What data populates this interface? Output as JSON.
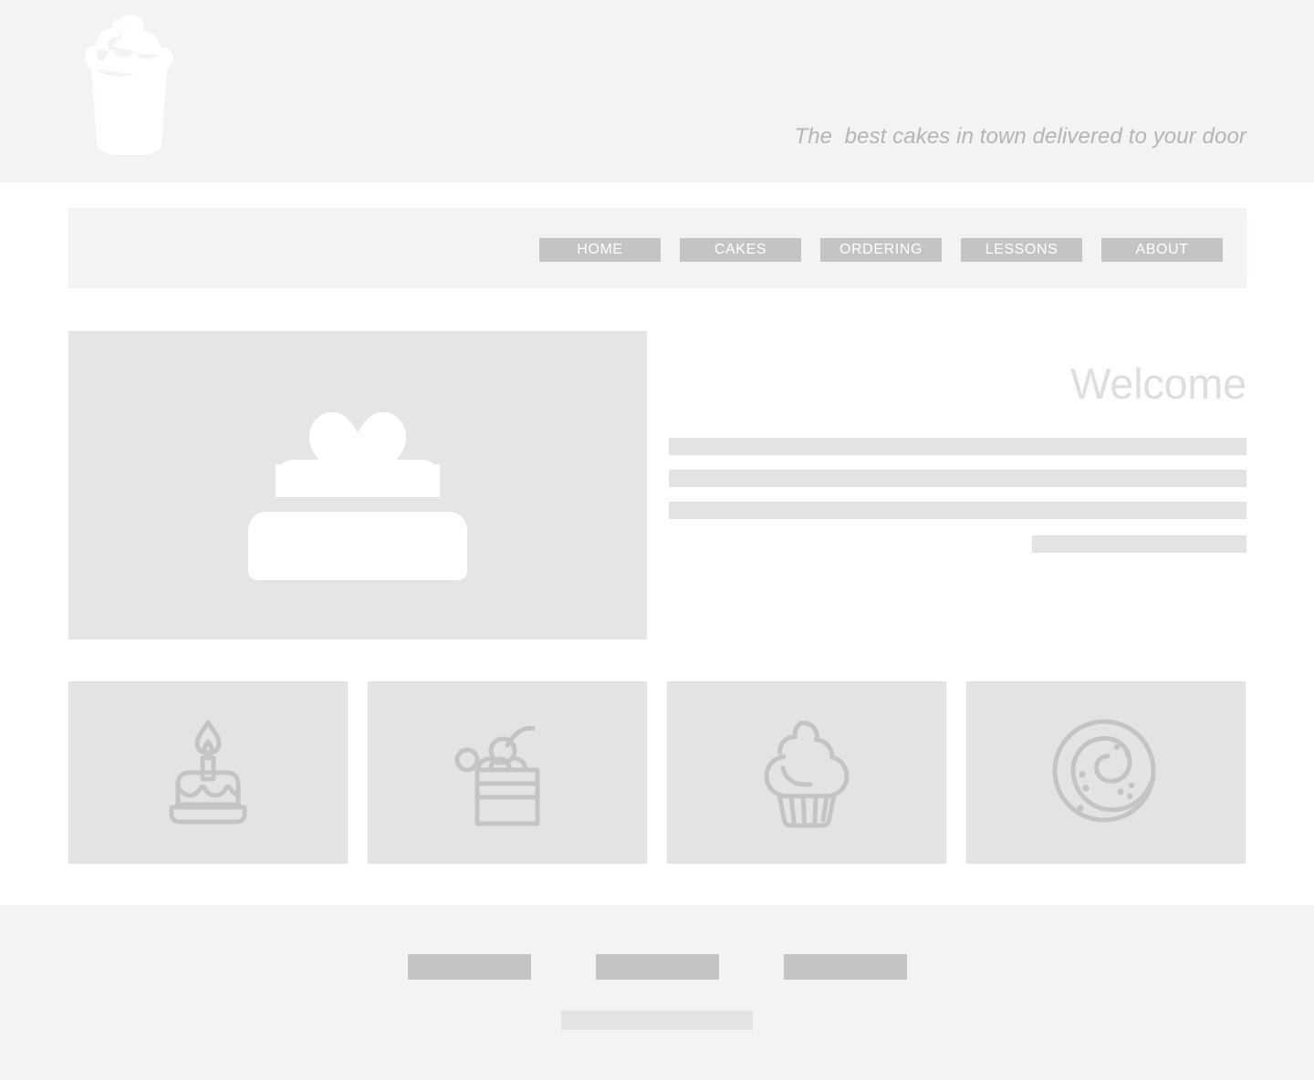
{
  "site": {
    "brand_logo_icon": "cupcake-logo-icon",
    "tagline": "The  best cakes in town delivered to your door"
  },
  "colors": {
    "header_bg": "#f4f2f3",
    "page_bg": "#ffffff",
    "nav_button": "#c4c4c4",
    "nav_button_text": "#ffffff",
    "placeholder_light": "#e3e3e3",
    "placeholder_image": "#e5e5e5",
    "heading_text": "#dedede",
    "tagline_text": "#b6b4b5",
    "footer_bg": "#f4f2f3",
    "footer_link": "#c4c4c4",
    "icon_stroke": "#c4c4c4",
    "logo_fill": "#ffffff"
  },
  "nav": {
    "items": [
      {
        "label": "HOME",
        "icon": "none"
      },
      {
        "label": "CAKES",
        "icon": "none"
      },
      {
        "label": "ORDERING",
        "icon": "none"
      },
      {
        "label": "LESSONS",
        "icon": "none"
      },
      {
        "label": "ABOUT",
        "icon": "none"
      }
    ]
  },
  "main": {
    "hero": {
      "image_icon": "wedding-cake-icon",
      "heading": "Welcome",
      "body_placeholder_lines": 4
    },
    "gallery": {
      "items": [
        {
          "icon": "birthday-cake-candle-icon"
        },
        {
          "icon": "cake-slice-cherry-icon"
        },
        {
          "icon": "cupcake-icon"
        },
        {
          "icon": "cinnamon-roll-icon"
        }
      ]
    }
  },
  "footer": {
    "links": [
      {
        "label": ""
      },
      {
        "label": ""
      },
      {
        "label": ""
      }
    ],
    "copyright_placeholder": ""
  }
}
